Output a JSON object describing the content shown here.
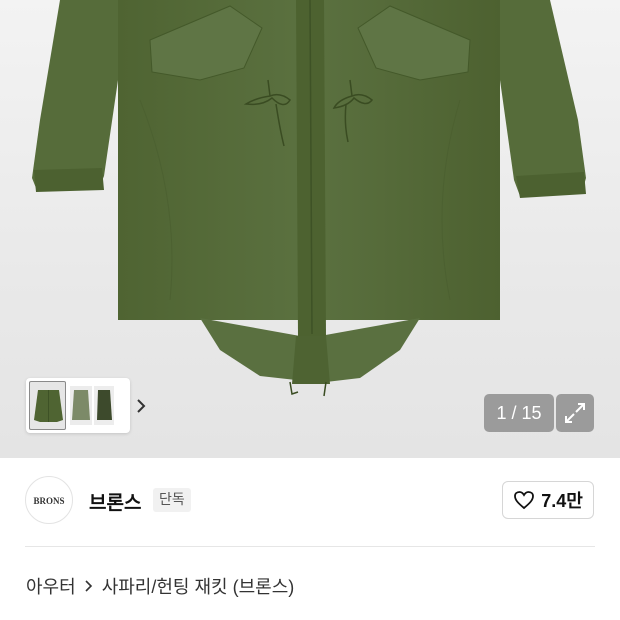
{
  "gallery": {
    "counter": "1 / 15",
    "thumbnail_count_visible": 3,
    "product_color": "#556b37"
  },
  "store": {
    "name": "브론스",
    "badge": "단독",
    "logo_text": "BRONS",
    "likes": "7.4만"
  },
  "breadcrumb": {
    "category": "아우터",
    "subcategory": "사파리/헌팅 재킷 (브론스)"
  },
  "icons": {
    "expand": "expand-icon",
    "heart": "heart-icon",
    "chevron": "chevron-right-icon"
  }
}
